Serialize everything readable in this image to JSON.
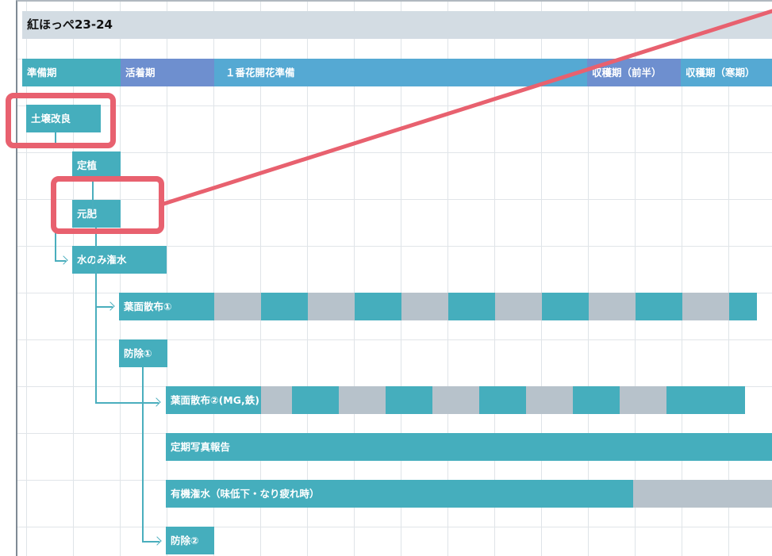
{
  "title": "紅ほっぺ23-24",
  "phases": [
    {
      "label": "準備期",
      "color": "#45aebd"
    },
    {
      "label": "活着期",
      "color": "#6e8fcf"
    },
    {
      "label": "１番花開花準備",
      "color": "#55a9d3"
    },
    {
      "label": "収穫期（前半）",
      "color": "#6e8fcf"
    },
    {
      "label": "収穫期（寒期）",
      "color": "#55a9d3"
    }
  ],
  "tasks": {
    "soil": "土壌改良",
    "planting": "定植",
    "base_fertilizer": "元肥",
    "water_only": "水のみ潅水",
    "foliar1": "葉面散布①",
    "pest1": "防除①",
    "foliar2": "葉面散布②(MG,鉄)",
    "photo_report": "定期写真報告",
    "organic_water": "有機潅水（味低下・なり疲れ時）",
    "pest2": "防除②"
  },
  "colors": {
    "accent": "#45aebd",
    "inactive": "#b7c2cb",
    "highlight": "#e8616f",
    "header_bg": "#d3dce3"
  }
}
